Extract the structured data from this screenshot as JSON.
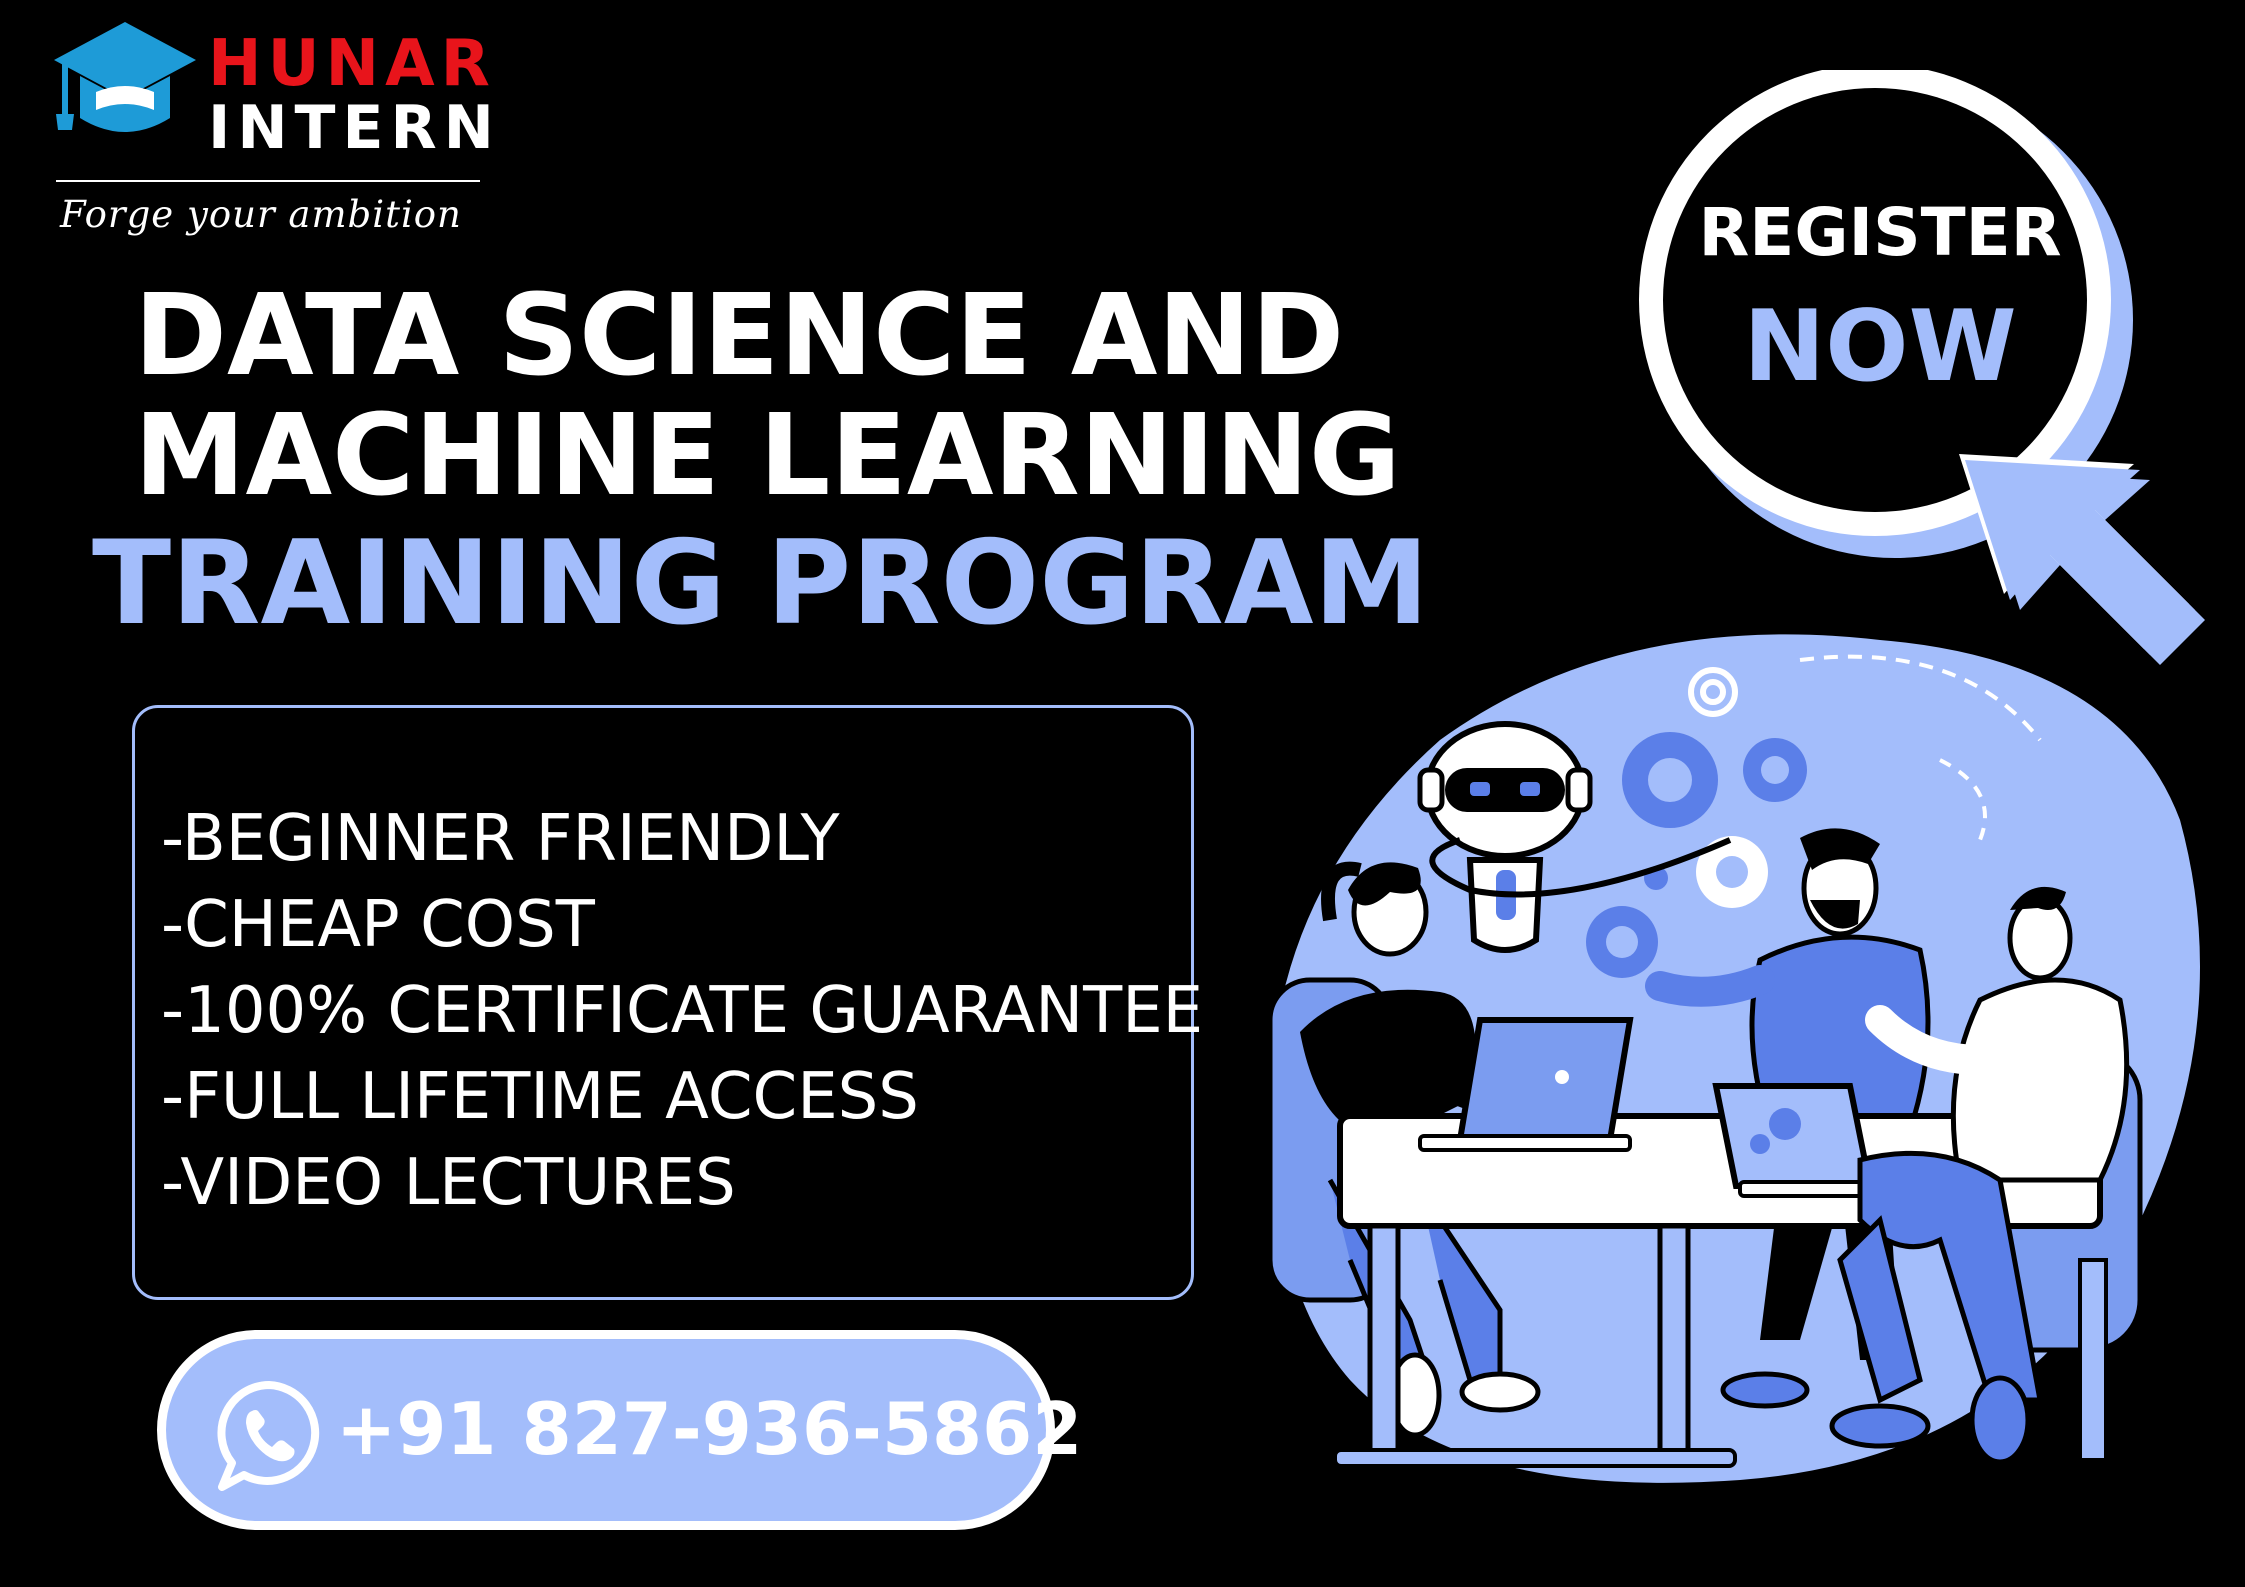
{
  "brand": {
    "name_top": "HUNAR",
    "name_bottom": "INTERN",
    "tagline": "Forge your ambition",
    "logo_icon": "graduation-cap-icon",
    "colors": {
      "red": "#e8141b",
      "cap_blue": "#1e9bd7"
    }
  },
  "headline": {
    "line1": "DATA SCIENCE AND",
    "line2": "MACHINE LEARNING",
    "line3": "TRAINING PROGRAM"
  },
  "features": {
    "items": [
      "-BEGINNER FRIENDLY",
      "-CHEAP COST",
      "-100% CERTIFICATE GUARANTEE",
      "-FULL LIFETIME ACCESS",
      "-VIDEO LECTURES"
    ]
  },
  "contact": {
    "icon": "whatsapp-icon",
    "phone": "+91 827-936-5862"
  },
  "cta": {
    "line1": "REGISTER",
    "line2": "NOW",
    "pointer_icon": "cursor-arrow-icon"
  },
  "illustration": {
    "subject": "team-with-robot-and-gears"
  },
  "theme": {
    "background": "#000000",
    "accent": "#a3bdfb",
    "accent_dark": "#5b7fe8",
    "text": "#ffffff"
  }
}
